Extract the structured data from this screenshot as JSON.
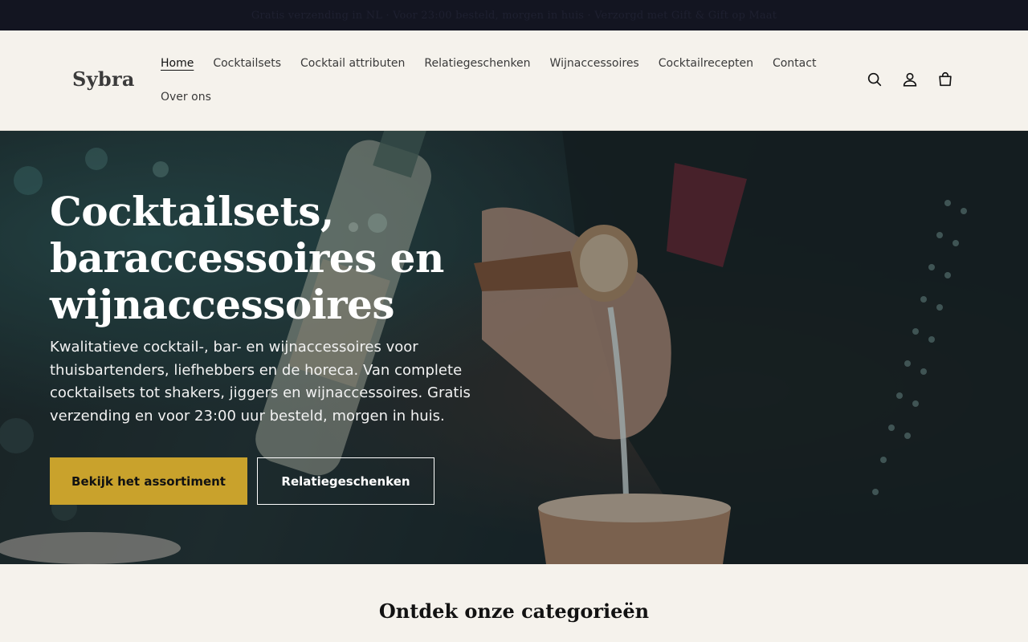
{
  "announcement": {
    "text": "Gratis verzending in NL · Voor 23:00 besteld, morgen in huis · Verzorgd met Gift & Gift op Maat"
  },
  "header": {
    "logo": "Sybra",
    "nav_row1": [
      "Home",
      "Cocktailsets",
      "Cocktail attributen",
      "Relatiegeschenken",
      "Wijnaccessoires",
      "Cocktailrecepten",
      "Contact"
    ],
    "nav_row2": [
      "Over ons"
    ],
    "active_item": "Home",
    "icons": [
      "search-icon",
      "account-icon",
      "cart-icon"
    ]
  },
  "hero": {
    "title_line1": "Cocktailsets,",
    "title_line2": "baraccessoires en",
    "title_line3": "wijnaccessoires",
    "text": "Kwalitatieve cocktail-, bar- en wijnaccessoires voor thuisbartenders, liefhebbers en de horeca. Van complete cocktailsets tot shakers, jiggers en wijnaccessoires. Gratis verzending en voor 23:00 uur besteld, morgen in huis.",
    "primary_button": "Bekijk het assortiment",
    "secondary_button": "Relatiegeschenken"
  },
  "categories": {
    "title": "Ontdek onze categorieën"
  },
  "colors": {
    "announcement_bg": "#131521",
    "header_bg": "#f5f2ec",
    "accent": "#c9a22c",
    "text": "#121212"
  }
}
